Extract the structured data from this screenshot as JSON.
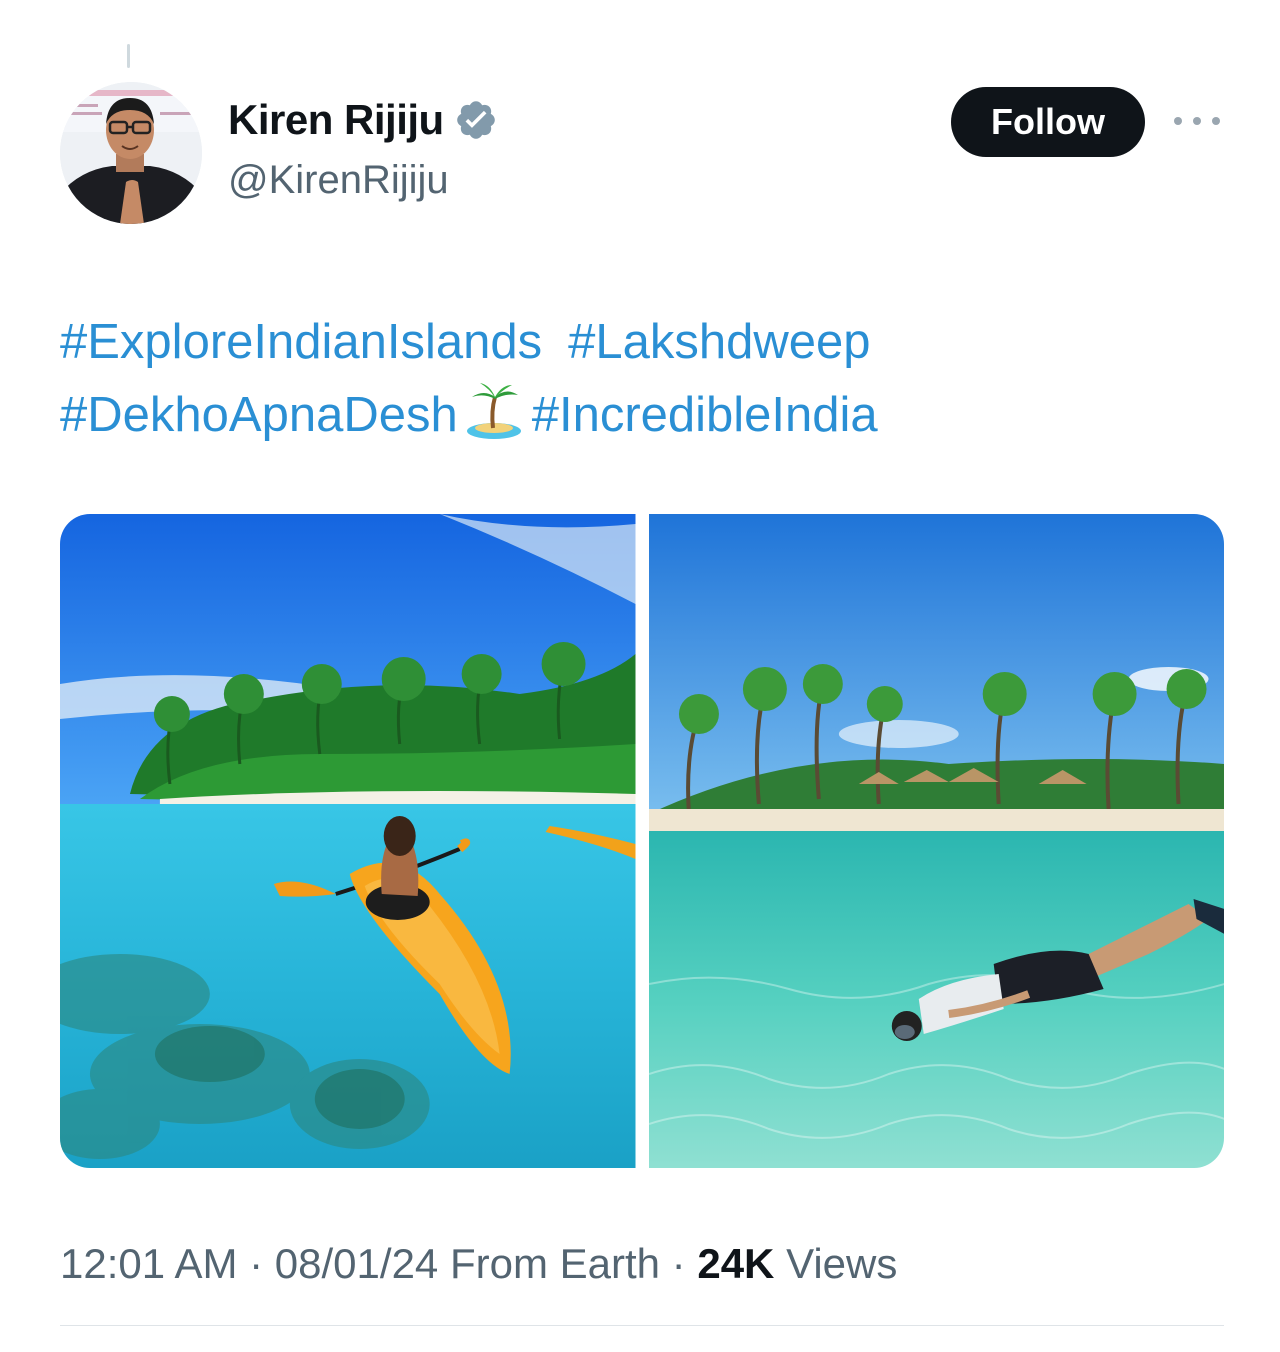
{
  "tweet": {
    "author": {
      "display_name": "Kiren Rijiju",
      "handle": "@KirenRijiju",
      "verified": true
    },
    "follow_label": "Follow",
    "text_lines": [
      [
        "#ExploreIndianIslands",
        "#Lakshdweep"
      ],
      [
        "#DekhoApnaDesh",
        "🏝",
        "#IncredibleIndia"
      ]
    ],
    "hashtags": {
      "h1": "#ExploreIndianIslands",
      "h2": "#Lakshdweep",
      "h3": "#DekhoApnaDesh",
      "h4": "#IncredibleIndia"
    },
    "emoji": "desert-island-emoji",
    "media": [
      {
        "description_icon": "kayak-photo"
      },
      {
        "description_icon": "snorkel-photo"
      }
    ],
    "meta": {
      "time": "12:01 AM",
      "sep1": " · ",
      "date": "08/01/24",
      "source": " From Earth",
      "sep2": " · ",
      "views_count": "24K",
      "views_label": " Views"
    }
  },
  "colors": {
    "link": "#2a8fd4",
    "verified_badge": "#829aab",
    "follow_bg": "#0f1419",
    "secondary_text": "#536471"
  }
}
